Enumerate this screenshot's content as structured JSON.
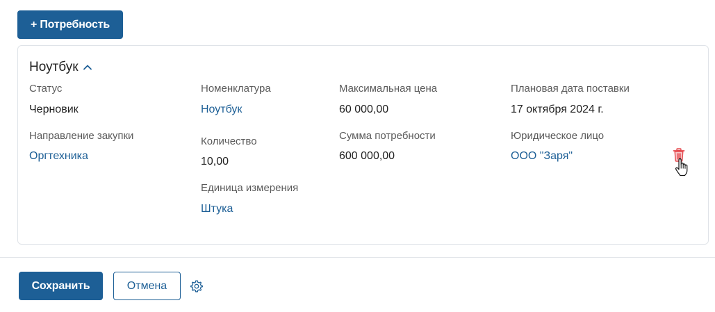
{
  "toolbar": {
    "add_need_label": "+ Потребность"
  },
  "card": {
    "title": "Ноутбук",
    "fields": {
      "status": {
        "label": "Статус",
        "value": "Черновик"
      },
      "purchase_direction": {
        "label": "Направление закупки",
        "value": "Оргтехника"
      },
      "nomenclature": {
        "label": "Номенклатура",
        "value": "Ноутбук"
      },
      "quantity": {
        "label": "Количество",
        "value": "10,00"
      },
      "unit": {
        "label": "Единица измерения",
        "value": "Штука"
      },
      "max_price": {
        "label": "Максимальная цена",
        "value": "60 000,00"
      },
      "need_sum": {
        "label": "Сумма потребности",
        "value": "600 000,00"
      },
      "planned_delivery": {
        "label": "Плановая дата поставки",
        "value": "17 октября 2024 г."
      },
      "legal_entity": {
        "label": "Юридическое лицо",
        "value": "ООО \"Заря\""
      }
    },
    "icons": {
      "collapse": "chevron-up-icon",
      "delete": "trash-icon"
    }
  },
  "footer": {
    "save_label": "Сохранить",
    "cancel_label": "Отмена",
    "settings_icon": "gear-icon"
  },
  "colors": {
    "primary": "#1d5f96",
    "link": "#1d5f96",
    "danger": "#e5484d",
    "border": "#dfe3e8"
  }
}
